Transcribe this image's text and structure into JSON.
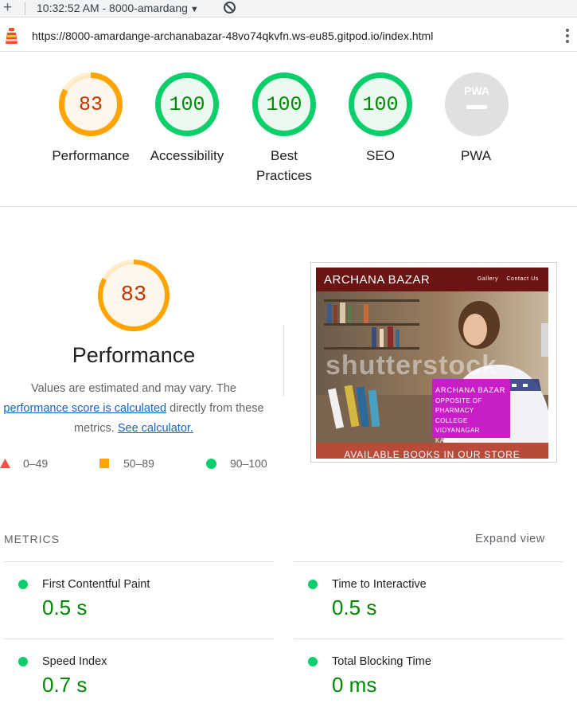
{
  "toolbar": {
    "plus_icon": "plus-icon",
    "run_label": "10:32:52 AM - 8000-amardang",
    "block_icon": "block-icon"
  },
  "urlbar": {
    "url": "https://8000-amardange-archanabazar-48vo74qkvfn.ws-eu85.gitpod.io/index.html"
  },
  "colors": {
    "pass": "#0cce6b",
    "average": "#ffa400",
    "fail": "#ff4e42",
    "pass_text": "#008800",
    "average_text": "#c33300"
  },
  "scores": [
    {
      "label": "Performance",
      "score": "83",
      "fraction": 0.83
    },
    {
      "label": "Accessibility",
      "score": "100",
      "fraction": 1.0
    },
    {
      "label": "Best Practices",
      "label_line1": "Best",
      "label_line2": "Practices",
      "score": "100",
      "fraction": 1.0
    },
    {
      "label": "SEO",
      "score": "100",
      "fraction": 1.0
    },
    {
      "label": "PWA",
      "badge": "PWA"
    }
  ],
  "performance": {
    "score": "83",
    "fraction": 0.83,
    "title": "Performance",
    "desc_1": "Values are estimated and may vary. The",
    "link_1": "performance score is calculated",
    "desc_2": " directly from these",
    "desc_3": "metrics. ",
    "link_2": "See calculator."
  },
  "legend": [
    {
      "shape": "triangle",
      "range": "0–49"
    },
    {
      "shape": "square",
      "range": "50–89"
    },
    {
      "shape": "circle",
      "range": "90–100"
    }
  ],
  "screenshot": {
    "brand": "ARCHANA BAZAR",
    "nav_gallery": "Gallery",
    "nav_contact": "Contact Us",
    "watermark": "shutterstock",
    "addr_1": "ARCHANA BAZAR",
    "addr_2": "OPPOSITE OF PHARMACY",
    "addr_3": "COLLEGE VIDYANAGAR",
    "addr_4": "KARAD",
    "strip": "AVAILABLE BOOKS IN OUR STORE"
  },
  "metrics": {
    "heading": "METRICS",
    "expand": "Expand view",
    "items": [
      {
        "name": "First Contentful Paint",
        "value": "0.5 s"
      },
      {
        "name": "Time to Interactive",
        "value": "0.5 s"
      },
      {
        "name": "Speed Index",
        "value": "0.7 s"
      },
      {
        "name": "Total Blocking Time",
        "value": "0 ms"
      }
    ]
  }
}
